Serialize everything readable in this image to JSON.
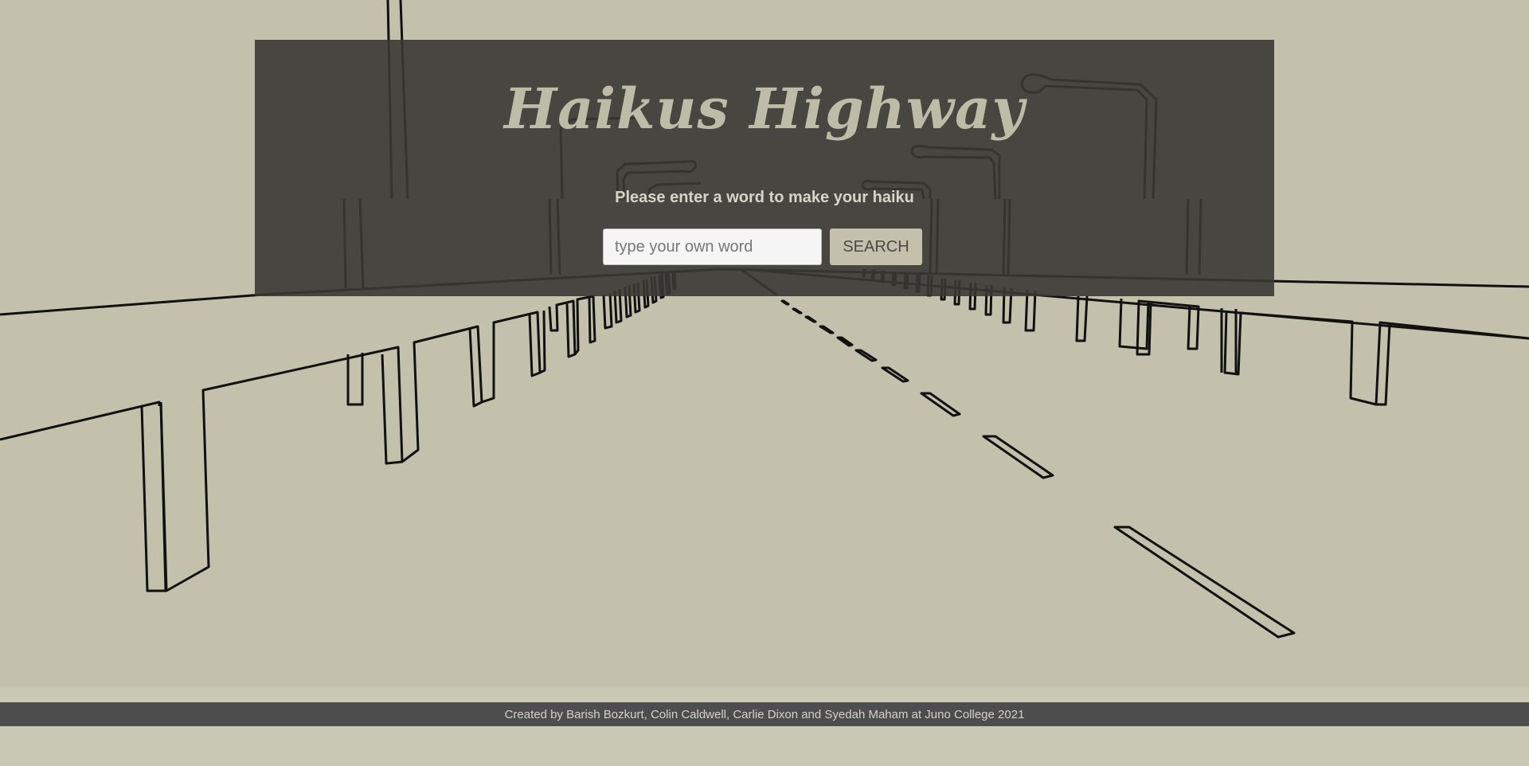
{
  "header": {
    "title": "Haikus Highway",
    "prompt": "Please enter a word to make your haiku"
  },
  "search": {
    "placeholder": "type your own word",
    "value": "",
    "button_label": "SEARCH"
  },
  "footer": {
    "credit": "Created by Barish Bozkurt, Colin Caldwell, Carlie Dixon and Syedah Maham at Juno College 2021"
  },
  "colors": {
    "page_background": "#c8c8b4",
    "scene_background": "#c3c0ab",
    "panel_background": "#3a3834",
    "title_color": "#bdbca6",
    "footer_background": "#4e4d4d"
  }
}
